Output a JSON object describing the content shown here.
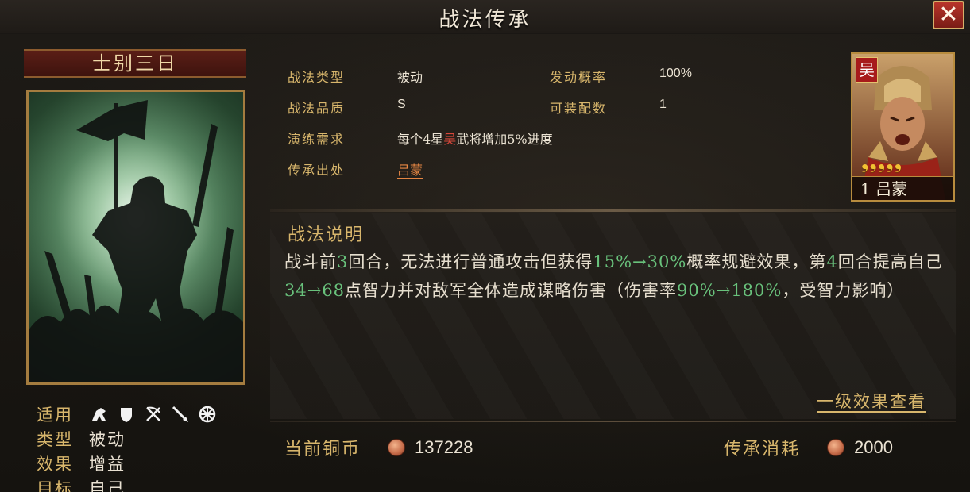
{
  "window": {
    "title": "战法传承",
    "close_label": "✕"
  },
  "skill": {
    "name": "士别三日",
    "meta": {
      "suitable_label": "适用",
      "suitable_icons": [
        "cavalry-icon",
        "shield-icon",
        "bow-icon",
        "spear-icon",
        "siege-icon"
      ],
      "type_label": "类型",
      "type_value": "被动",
      "effect_label": "效果",
      "effect_value": "增益",
      "target_label": "目标",
      "target_value": "自己"
    }
  },
  "info": {
    "skill_type_label": "战法类型",
    "skill_type_value": "被动",
    "trigger_rate_label": "发动概率",
    "trigger_rate_value": "100%",
    "quality_label": "战法品质",
    "quality_value": "S",
    "equip_count_label": "可装配数",
    "equip_count_value": "1",
    "drill_label": "演练需求",
    "drill_prefix": "每个4星",
    "drill_faction": "吴",
    "drill_suffix": "武将增加5%进度",
    "origin_label": "传承出处",
    "origin_value": "吕蒙"
  },
  "hero": {
    "faction": "吴",
    "stars": 5,
    "star_glyph": "❟",
    "name_line": "1 吕蒙"
  },
  "description": {
    "title": "战法说明",
    "t1": "战斗前",
    "n1": "3",
    "t2": "回合，无法进行普通攻击但获得",
    "n2": "15%→30%",
    "t3": "概率规避效果，第",
    "n3": "4",
    "t4": "回合提高自己",
    "n4": "34→68",
    "t5": "点智力并对敌军全体造成谋略伤害（伤害率",
    "n5": "90%→180%",
    "t6": "，受智力影响）",
    "effect_link": "一级效果查看"
  },
  "footer": {
    "current_coin_label": "当前铜币",
    "current_coin_value": "137228",
    "inherit_cost_label": "传承消耗",
    "inherit_cost_value": "2000"
  }
}
